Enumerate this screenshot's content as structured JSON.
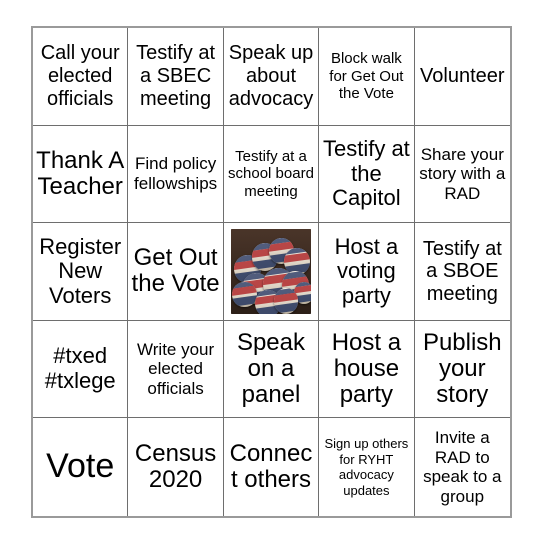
{
  "card": {
    "type": "bingo-card",
    "columns": 5,
    "rows": 5,
    "background_color": "#ffffff",
    "grid_border_color": "#6e6e6e",
    "text_color": "#000000",
    "cells": [
      {
        "id": "r1c1",
        "text": "Call your elected officials",
        "size": "lg",
        "kind": "text"
      },
      {
        "id": "r1c2",
        "text": "Testify at a SBEC meeting",
        "size": "lg",
        "kind": "text"
      },
      {
        "id": "r1c3",
        "text": "Speak up about advocacy",
        "size": "lg",
        "kind": "text"
      },
      {
        "id": "r1c4",
        "text": "Block walk for Get Out the Vote",
        "size": "sm",
        "kind": "text"
      },
      {
        "id": "r1c5",
        "text": "Volunteer",
        "size": "lg",
        "kind": "text"
      },
      {
        "id": "r2c1",
        "text": "Thank A Teacher",
        "size": "xxl",
        "kind": "text"
      },
      {
        "id": "r2c2",
        "text": "Find policy fellowships",
        "size": "md",
        "kind": "text"
      },
      {
        "id": "r2c3",
        "text": "Testify at a school board meeting",
        "size": "sm",
        "kind": "text"
      },
      {
        "id": "r2c4",
        "text": "Testify at the Capitol",
        "size": "xl",
        "kind": "text"
      },
      {
        "id": "r2c5",
        "text": "Share your story with a RAD",
        "size": "md",
        "kind": "text"
      },
      {
        "id": "r3c1",
        "text": "Register New Voters",
        "size": "xl",
        "kind": "text"
      },
      {
        "id": "r3c2",
        "text": "Get Out the Vote",
        "size": "xxl",
        "kind": "text"
      },
      {
        "id": "r3c3",
        "text": "",
        "size": "md",
        "kind": "image",
        "image_alt": "photo of I VOTE campaign buttons piled on a wooden table"
      },
      {
        "id": "r3c4",
        "text": "Host a voting party",
        "size": "xl",
        "kind": "text"
      },
      {
        "id": "r3c5",
        "text": "Testify at a SBOE meeting",
        "size": "lg",
        "kind": "text"
      },
      {
        "id": "r4c1",
        "text": "#txed #txlege",
        "size": "xl",
        "kind": "text"
      },
      {
        "id": "r4c2",
        "text": "Write your elected officials",
        "size": "md",
        "kind": "text"
      },
      {
        "id": "r4c3",
        "text": "Speak on a panel",
        "size": "xxl",
        "kind": "text"
      },
      {
        "id": "r4c4",
        "text": "Host a house party",
        "size": "xxl",
        "kind": "text"
      },
      {
        "id": "r4c5",
        "text": "Publish your story",
        "size": "xxl",
        "kind": "text"
      },
      {
        "id": "r5c1",
        "text": "Vote",
        "size": "huge",
        "kind": "text"
      },
      {
        "id": "r5c2",
        "text": "Census 2020",
        "size": "xxl",
        "kind": "text"
      },
      {
        "id": "r5c3",
        "text": "Connect others",
        "size": "xxl",
        "kind": "text"
      },
      {
        "id": "r5c4",
        "text": "Sign up others for RYHT advocacy updates",
        "size": "xs",
        "kind": "text"
      },
      {
        "id": "r5c5",
        "text": "Invite a RAD to speak to a group",
        "size": "md",
        "kind": "text"
      }
    ]
  }
}
